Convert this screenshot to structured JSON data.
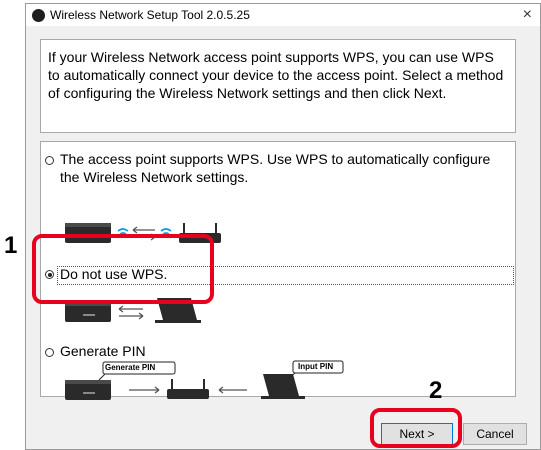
{
  "window": {
    "title": "Wireless Network Setup Tool 2.0.5.25",
    "close_glyph": "×"
  },
  "intro": {
    "text": "If your Wireless Network access point supports WPS, you can use WPS to automatically connect your device to the access point. Select a method of configuring the Wireless Network settings and then click Next."
  },
  "options": [
    {
      "label": "The access point supports WPS. Use WPS to automatically configure the Wireless Network settings.",
      "selected": false
    },
    {
      "label": "Do not use WPS.",
      "selected": true
    },
    {
      "label": "Generate PIN",
      "selected": false
    }
  ],
  "pin_diagram": {
    "generate_callout": "Generate PIN",
    "input_callout": "Input PIN"
  },
  "annotations": {
    "step1": "1",
    "step2": "2",
    "highlight_color": "#e8001c"
  },
  "buttons": {
    "next": "Next >",
    "cancel": "Cancel"
  },
  "icons": {
    "wifi": "wifi-icon",
    "arrows": "bidirectional-arrows-icon",
    "printer": "printer-icon",
    "router": "router-icon",
    "laptop": "laptop-icon"
  }
}
